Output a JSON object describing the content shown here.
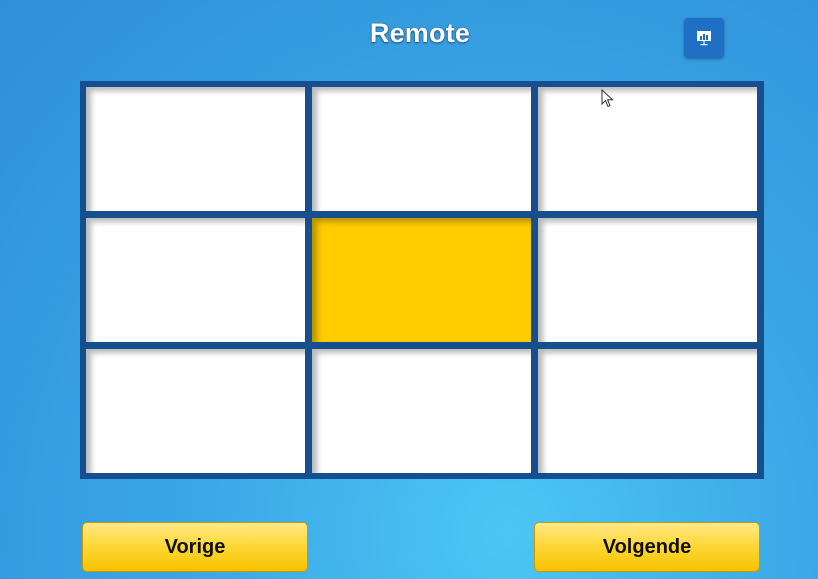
{
  "header": {
    "title": "Remote",
    "present_icon": "presentation-screen-icon"
  },
  "grid": {
    "rows": 3,
    "columns": 3,
    "active_cell": 5,
    "colors": {
      "cell": "#ffffff",
      "active": "#ffcc00",
      "border": "#154f8e"
    }
  },
  "footer": {
    "prev_label": "Vorige",
    "next_label": "Volgende"
  },
  "theme": {
    "background": "#3aa6e6",
    "button": "#ffd93a"
  }
}
